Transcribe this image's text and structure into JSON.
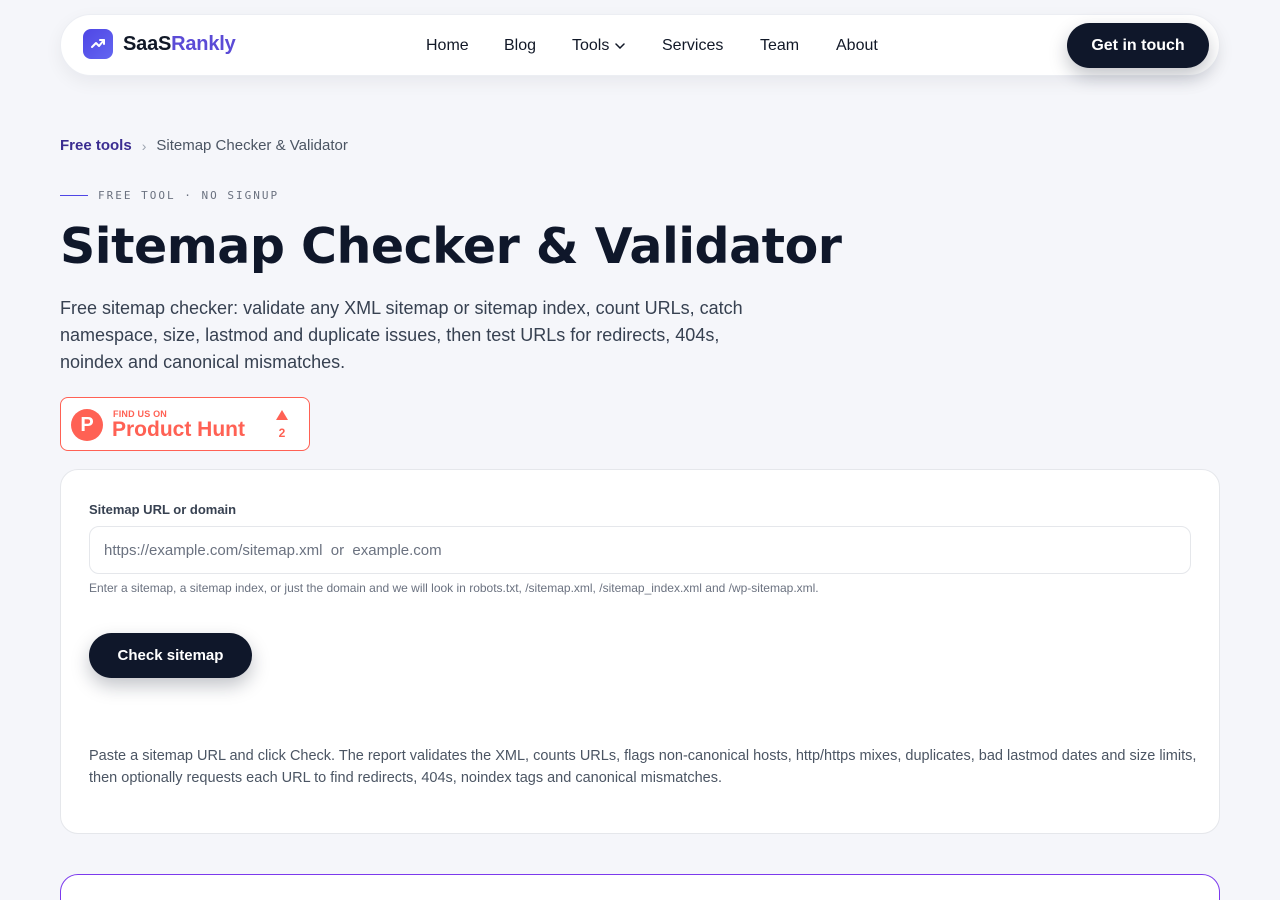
{
  "brand": {
    "part1": "SaaS",
    "part2": "Rankly"
  },
  "nav": {
    "items": [
      {
        "label": "Home"
      },
      {
        "label": "Blog"
      },
      {
        "label": "Tools"
      },
      {
        "label": "Services"
      },
      {
        "label": "Team"
      },
      {
        "label": "About"
      }
    ],
    "cta_label": "Get in touch"
  },
  "breadcrumb": {
    "parent": "Free tools",
    "separator": "›",
    "current": "Sitemap Checker & Validator"
  },
  "hero": {
    "eyebrow": "FREE TOOL · NO SIGNUP",
    "title": "Sitemap Checker & Validator",
    "lead": "Free sitemap checker: validate any XML sitemap or sitemap index, count URLs, catch namespace, size, lastmod and duplicate issues, then test URLs for redirects, 404s, noindex and canonical mismatches."
  },
  "product_hunt": {
    "small": "FIND US ON",
    "big": "Product Hunt",
    "votes": "2",
    "color": "#ff6154"
  },
  "form": {
    "label": "Sitemap URL or domain",
    "value": "",
    "placeholder": "https://example.com/sitemap.xml  or  example.com",
    "hint": "Enter a sitemap, a sitemap index, or just the domain and we will look in robots.txt, /sitemap.xml, /sitemap_index.xml and /wp-sitemap.xml.",
    "button_label": "Check sitemap",
    "description": "Paste a sitemap URL and click Check. The report validates the XML, counts URLs, flags non-canonical hosts, http/https mixes, duplicates, bad lastmod dates and size limits, then optionally requests each URL to find redirects, 404s, noindex tags and canonical mismatches."
  },
  "colors": {
    "accent": "#4f46e5",
    "dark": "#0f172a",
    "background": "#f5f6fa"
  }
}
